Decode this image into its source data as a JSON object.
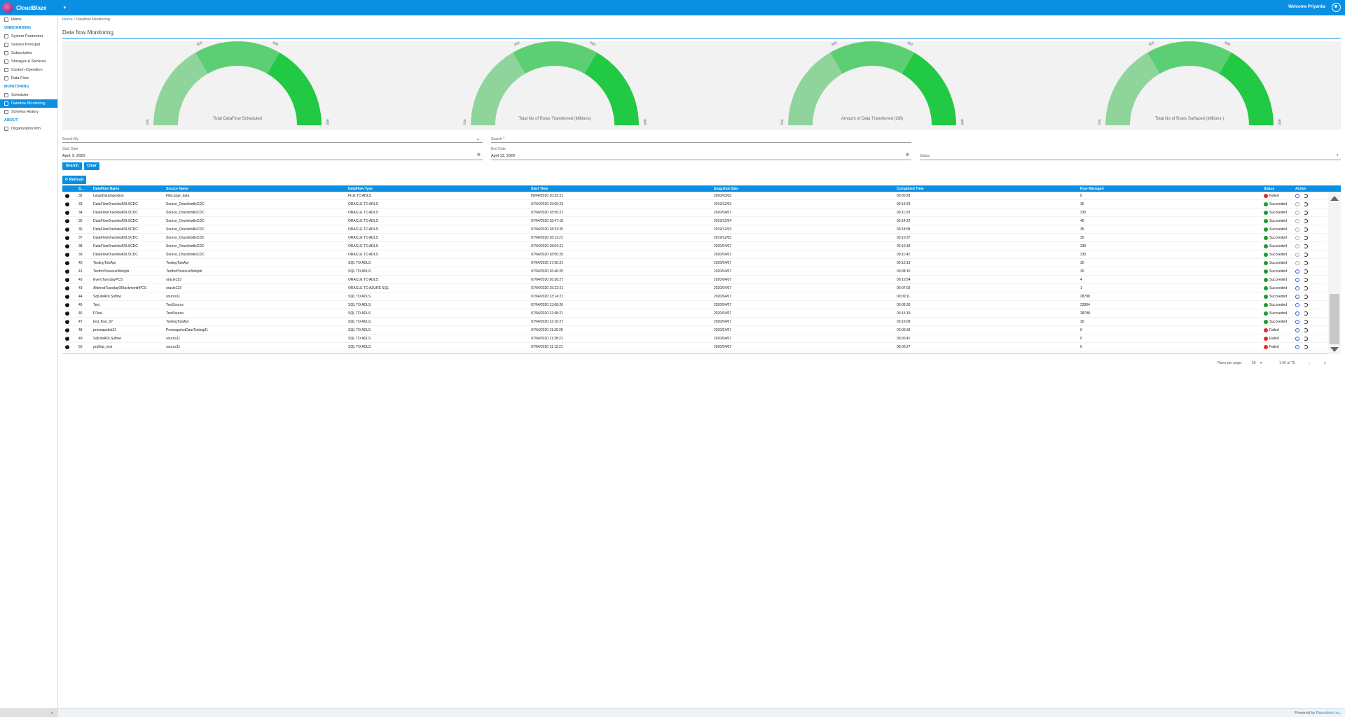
{
  "header": {
    "app_name": "CloudBlaze",
    "menu_icon": "chevron-down-icon",
    "welcome": "Welcome Priyanka",
    "user_icon": "user-circle-icon"
  },
  "sidebar": {
    "items": [
      {
        "label": "Home",
        "icon": "home-icon"
      },
      {
        "section": "ONBOARDING"
      },
      {
        "label": "System Parameter",
        "icon": "parameter-icon"
      },
      {
        "label": "Service Principal",
        "icon": "doc-icon"
      },
      {
        "label": "Subscription",
        "icon": "card-icon"
      },
      {
        "label": "Storages & Services",
        "icon": "storage-icon"
      },
      {
        "label": "Custom Operation",
        "icon": "operation-icon"
      },
      {
        "label": "Data Flow",
        "icon": "flow-icon"
      },
      {
        "section": "MONITORING"
      },
      {
        "label": "Scheduler",
        "icon": "calendar-icon"
      },
      {
        "label": "Dataflow Monitoring",
        "icon": "monitor-icon",
        "active": true
      },
      {
        "label": "Schema History",
        "icon": "history-icon"
      },
      {
        "section": "ABOUT"
      },
      {
        "label": "Organization Info",
        "icon": "building-icon"
      }
    ],
    "collapse": "‹"
  },
  "breadcrumb": {
    "home": "Home",
    "separator": "/",
    "current": "Dataflow Monitoring"
  },
  "page_title": "Data flow Monitoring",
  "gauges": [
    {
      "label": "Total DataFlow Scheduled",
      "ticks": [
        "200",
        "400",
        "600",
        "800"
      ]
    },
    {
      "label": "Total No of Rows Transferred (Millions)",
      "ticks": [
        "200",
        "400",
        "600",
        "800"
      ]
    },
    {
      "label": "Amount of Data Transferred (GB)",
      "ticks": [
        "200",
        "400",
        "600",
        "800"
      ]
    },
    {
      "label": "Total No of Rows Surfaced (Millions )",
      "ticks": [
        "200",
        "400",
        "600",
        "800"
      ]
    }
  ],
  "filters": {
    "search_by_label": "Search By",
    "search_label": "Search *",
    "start_date_label": "Start Date",
    "start_date_value": "April, 9, 2020",
    "end_date_label": "End Date",
    "end_date_value": "April 13, 2020",
    "status_label": "Status",
    "search_button": "Search",
    "clear_button": "Clear",
    "refresh_button": "Refresh"
  },
  "table": {
    "headers": [
      "S...",
      "DataFlow Name",
      "Source Name",
      "DataFlow Type",
      "Start Time",
      "Snapshot Date",
      "Completed Time",
      "Row Managed",
      "Status",
      "Action"
    ],
    "rows": [
      [
        "32",
        "LargeDataIngestion",
        "FileLarge_data",
        "FILE TO ADLS",
        "09/04/2020 10:22:21",
        "2020/03/03",
        "00:00:28",
        "0",
        "Failed"
      ],
      [
        "33",
        "DataFlowOracletoADLSCDC",
        "Source_OracletodlsCDC",
        "ORACLE TO ADLS",
        "07/04/2020 19:00:23",
        "2019/12/03",
        "00:13:29",
        "35",
        "Succeeded"
      ],
      [
        "34",
        "DataFlowOracletoADLSCDC",
        "Source_OracletodlsCDC",
        "ORACLE TO ADLS",
        "07/04/2020 18:50:21",
        "2020/04/07",
        "00:11:29",
        "330",
        "Succeeded"
      ],
      [
        "35",
        "DataFlowOracletoADLSCDC",
        "Source_OracletodlsCDC",
        "ORACLE TO ADLS",
        "07/04/2020 18:47:18",
        "2019/12/04",
        "00:14:22",
        "45",
        "Succeeded"
      ],
      [
        "36",
        "DataFlowOracletoADLSCDC",
        "Source_OracletodlsCDC",
        "ORACLE TO ADLS",
        "07/04/2020 18:33:25",
        "2019/12/03",
        "00:18:08",
        "35",
        "Succeeded"
      ],
      [
        "37",
        "DataFlowOracletoADLSCDC",
        "Source_OracletodlsCDC",
        "ORACLE TO ADLS",
        "07/04/2020 18:11:21",
        "2019/12/03",
        "00:10:37",
        "35",
        "Succeeded"
      ],
      [
        "38",
        "DataFlowOracletoADLSCDC",
        "Source_OracletodlsCDC",
        "ORACLE TO ADLS",
        "07/04/2020 18:04:21",
        "2020/04/07",
        "00:10:18",
        "330",
        "Succeeded"
      ],
      [
        "39",
        "DataFlowOracletoADLSCDC",
        "Source_OracletodlsCDC",
        "ORACLE TO ADLS",
        "07/04/2020 18:00:25",
        "2020/04/07",
        "00:11:42",
        "330",
        "Succeeded"
      ],
      [
        "40",
        "TestingToisApr",
        "TestingToisApr",
        "SQL TO ADLS",
        "07/04/2020 17:50:21",
        "2020/04/07",
        "00:10:13",
        "30",
        "Succeeded"
      ],
      [
        "41",
        "TestforPreviousWebjob",
        "TestforPreviousWebjob",
        "SQL TO ADLS",
        "07/04/2020 16:46:25",
        "2020/04/07",
        "00:08:10",
        "30",
        "Succeeded"
      ],
      [
        "42",
        "EveryTuesdayPCS",
        "oracle123",
        "ORACLE TO ADLS",
        "07/04/2020 16:36:27",
        "2020/04/07",
        "00:10:54",
        "4",
        "Succeeded"
      ],
      [
        "43",
        "AlternatTuesdayOf3ackmonthPCS",
        "oracle123",
        "ORACLE TO AZURE SQL",
        "07/04/2020 15:22:21",
        "2020/04/07",
        "00:07:03",
        "1",
        "Succeeded"
      ],
      [
        "44",
        "SqlLiteADLSuflow",
        "source11",
        "SQL TO ADLS",
        "07/04/2020 13:14:21",
        "2020/04/07",
        "00:09:11",
        "28798",
        "Succeeded"
      ],
      [
        "45",
        "Test",
        "TestSource",
        "SQL TO ADLS",
        "07/04/2020 13:08:26",
        "2020/04/07",
        "00:09:30",
        "22804",
        "Succeeded"
      ],
      [
        "46",
        "DTest",
        "TestSource",
        "SQL TO ADLS",
        "07/04/2020 12:48:21",
        "2020/04/07",
        "00:15:19",
        "28798",
        "Succeeded"
      ],
      [
        "47",
        "test_flow_07",
        "TestingToisApr",
        "SQL TO ADLS",
        "07/04/2020 12:16:27",
        "2020/04/07",
        "00:16:09",
        "30",
        "Succeeded"
      ],
      [
        "48",
        "presnapshot31",
        "PresnapshotDateTesting31",
        "SQL TO ADLS",
        "07/04/2020 11:30:25",
        "2020/04/07",
        "00:00:33",
        "0",
        "Failed"
      ],
      [
        "49",
        "SqlLiteADLSuflow",
        "source11",
        "SQL TO ADLS",
        "07/04/2020 11:28:21",
        "2020/04/07",
        "00:00:41",
        "0",
        "Failed"
      ],
      [
        "50",
        "pruflow_test",
        "source11",
        "SQL TO ADLS",
        "07/04/2020 11:13:21",
        "2020/04/07",
        "00:00:27",
        "0",
        "Failed"
      ]
    ]
  },
  "pagination": {
    "rows_per_page_label": "Rows per page:",
    "rows_per_page": "50",
    "range": "1-50 of 75",
    "prev": "‹",
    "next": "›"
  },
  "footer": {
    "powered_by": "Powered by",
    "company": "Ravoubes Inc."
  },
  "colors": {
    "brand": "#0a8fe3",
    "gauge_light": "#8fd49b",
    "gauge_mid": "#5ccf74",
    "gauge_dark": "#22c944",
    "success": "#1a9b2f",
    "failed": "#e02b2b"
  }
}
